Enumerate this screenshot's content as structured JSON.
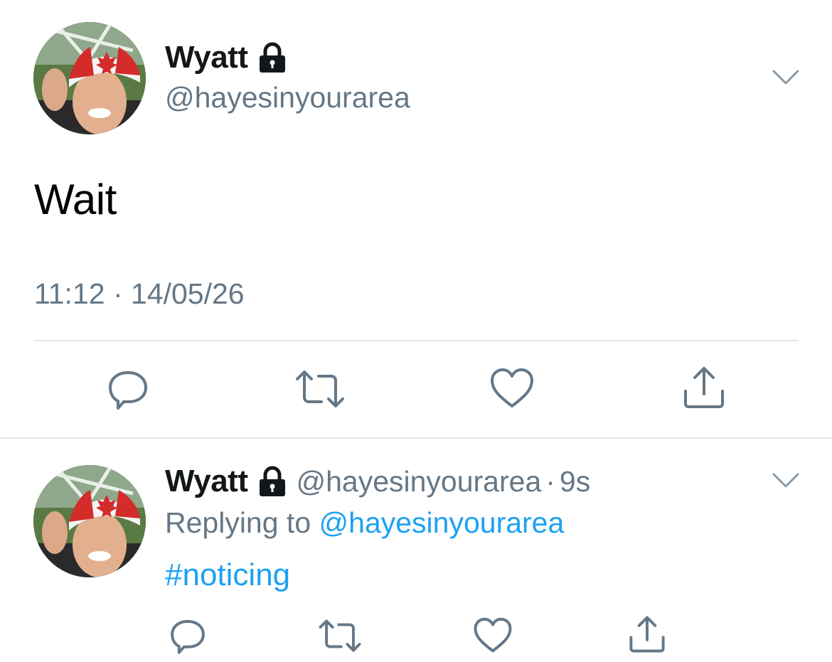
{
  "main_tweet": {
    "name": "Wyatt",
    "handle": "@hayesinyourarea",
    "text": "Wait",
    "timestamp": "11:12 · 14/05/26",
    "lock_icon": "lock-icon",
    "menu_icon": "chevron-down-icon",
    "actions": [
      "reply-icon",
      "retweet-icon",
      "like-icon",
      "share-icon"
    ]
  },
  "reply_tweet": {
    "name": "Wyatt",
    "handle": "@hayesinyourarea",
    "separator": "·",
    "time": "9s",
    "replying_prefix": "Replying to",
    "replying_to": "@hayesinyourarea",
    "text": "#noticing",
    "lock_icon": "lock-icon",
    "menu_icon": "chevron-down-icon",
    "actions": [
      "reply-icon",
      "retweet-icon",
      "like-icon",
      "share-icon"
    ]
  },
  "colors": {
    "text_primary": "#14171a",
    "text_secondary": "#657786",
    "link": "#1da1f2",
    "divider": "#e1e8ed"
  }
}
